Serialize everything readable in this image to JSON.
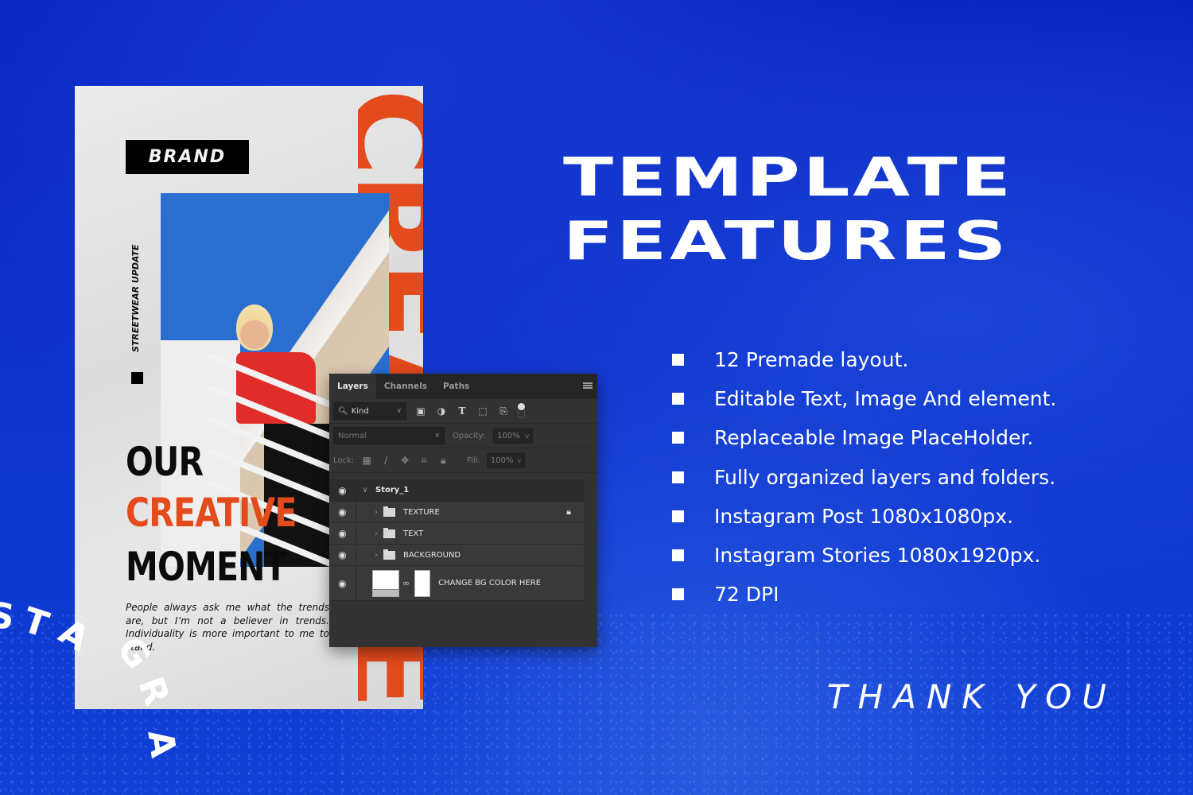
{
  "poster": {
    "brand": "BRAND",
    "vertical_tag": "STREETWEAR UPDATE",
    "orange_vertical_word": "CREATIVE",
    "headline": [
      "OUR",
      "CREATIVE",
      "MOMENT"
    ],
    "body": "People always ask me what the trends are, but I’m not a believer in trends. Individuality is more important to me to stand.",
    "colors": {
      "accent": "#e34a1c",
      "paper": "#e6e6e6",
      "ink": "#0b0b0b"
    }
  },
  "curved_text": [
    "S",
    "T",
    "A",
    "G",
    "R",
    "A"
  ],
  "layers_panel": {
    "tabs": [
      {
        "label": "Layers",
        "active": true
      },
      {
        "label": "Channels",
        "active": false
      },
      {
        "label": "Paths",
        "active": false
      }
    ],
    "filter": {
      "label": "Kind"
    },
    "filter_icons": [
      "image-filter-icon",
      "adjustment-filter-icon",
      "type-filter-icon",
      "shape-filter-icon",
      "smart-object-filter-icon"
    ],
    "blend_mode": "Normal",
    "opacity_label": "Opacity:",
    "opacity_value": "100%",
    "lock_label": "Lock:",
    "fill_label": "Fill:",
    "fill_value": "100%",
    "layers": [
      {
        "name": "Story_1",
        "type": "group-open",
        "visible": true
      },
      {
        "name": "TEXTURE",
        "type": "folder",
        "visible": true,
        "locked": true
      },
      {
        "name": "TEXT",
        "type": "folder",
        "visible": true,
        "locked": false
      },
      {
        "name": "BACKGROUND",
        "type": "folder",
        "visible": true,
        "locked": false
      },
      {
        "name": "CHANGE BG COLOR HERE",
        "type": "fill-layer",
        "visible": true,
        "locked": false
      }
    ]
  },
  "main": {
    "title_line1": "TEMPLATE",
    "title_line2": "FEATURES",
    "features": [
      "12 Premade layout.",
      "Editable Text, Image And element.",
      "Replaceable Image PlaceHolder.",
      "Fully organized layers and folders.",
      "Instagram Post 1080x1080px.",
      "Instagram Stories 1080x1920px.",
      "72 DPI"
    ],
    "footer": "THANK YOU"
  },
  "colors": {
    "background": "#0a2fc4",
    "text": "#ffffff",
    "panel": "#323232"
  }
}
